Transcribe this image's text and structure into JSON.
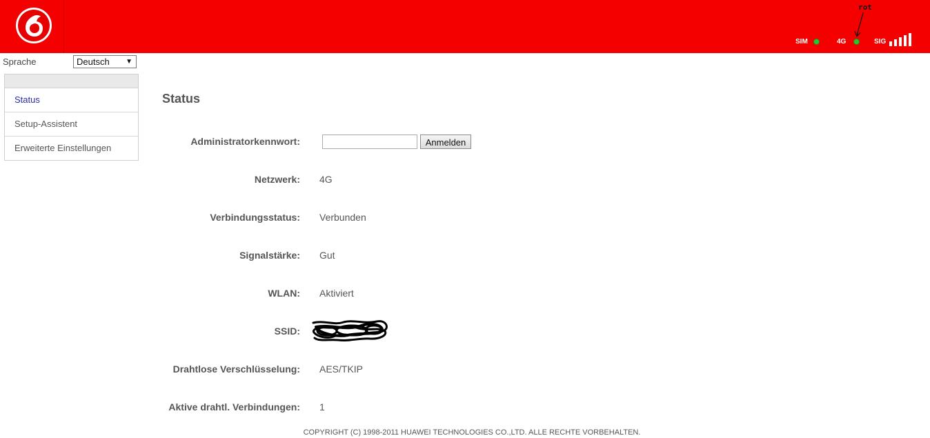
{
  "header": {
    "annotation": "rot",
    "indicators": [
      {
        "label": "SIM",
        "status_color": "#2fc42f"
      },
      {
        "label": "4G",
        "status_color": "#2fc42f"
      },
      {
        "label": "SIG"
      }
    ],
    "signal_bars": 5,
    "brand_color": "#f40000"
  },
  "language": {
    "label": "Sprache",
    "selected": "Deutsch"
  },
  "sidebar": {
    "items": [
      {
        "label": "Status",
        "active": true
      },
      {
        "label": "Setup-Assistent",
        "active": false
      },
      {
        "label": "Erweiterte Einstellungen",
        "active": false
      }
    ]
  },
  "main": {
    "title": "Status",
    "admin_password": {
      "label": "Administratorkennwort:",
      "value": "",
      "button": "Anmelden"
    },
    "rows": [
      {
        "label": "Netzwerk:",
        "value": "4G"
      },
      {
        "label": "Verbindungsstatus:",
        "value": "Verbunden"
      },
      {
        "label": "Signalstärke:",
        "value": "Gut"
      },
      {
        "label": "WLAN:",
        "value": "Aktiviert"
      },
      {
        "label": "SSID:",
        "value": ""
      },
      {
        "label": "Drahtlose Verschlüsselung:",
        "value": "AES/TKIP"
      },
      {
        "label": "Aktive drahtl. Verbindungen:",
        "value": "1"
      }
    ]
  },
  "footer": {
    "copyright": "COPYRIGHT (C) 1998-2011 HUAWEI TECHNOLOGIES CO.,LTD. ALLE RECHTE VORBEHALTEN."
  }
}
